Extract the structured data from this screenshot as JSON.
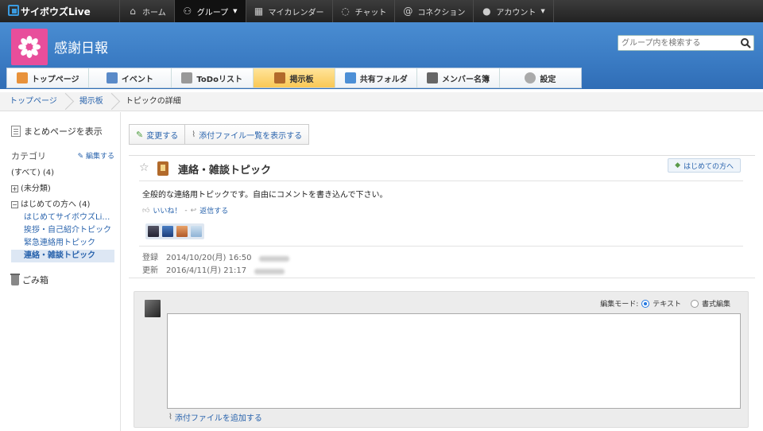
{
  "topnav": {
    "logo_text": "サイボウズLive",
    "items": [
      {
        "label": "ホーム",
        "icon": "home-icon"
      },
      {
        "label": "グループ",
        "icon": "group-icon"
      },
      {
        "label": "マイカレンダー",
        "icon": "calendar-icon"
      },
      {
        "label": "チャット",
        "icon": "chat-icon"
      },
      {
        "label": "コネクション",
        "icon": "at-icon"
      },
      {
        "label": "アカウント",
        "icon": "person-icon"
      }
    ]
  },
  "header": {
    "group_title": "感謝日報",
    "search_placeholder": "グループ内を検索する"
  },
  "tabs": [
    {
      "label": "トップページ",
      "color": "#e8923b"
    },
    {
      "label": "イベント",
      "color": "#5a8ac8"
    },
    {
      "label": "ToDoリスト",
      "color": "#999999"
    },
    {
      "label": "掲示板",
      "color": "#b26a2b"
    },
    {
      "label": "共有フォルダ",
      "color": "#4c8fd6"
    },
    {
      "label": "メンバー名簿",
      "color": "#666666"
    },
    {
      "label": "設定",
      "color": "#aaaaaa"
    }
  ],
  "breadcrumb": [
    "トップページ",
    "掲示板",
    "トピックの詳細"
  ],
  "sidebar": {
    "summary_label": "まとめページを表示",
    "category_label": "カテゴリ",
    "edit_label": "編集する",
    "all_label": "(すべて)  (4)",
    "uncat_label": "(未分類)",
    "group_label": "はじめての方へ  (4)",
    "topics": [
      "はじめてサイボウズLi…",
      "挨拶・自己紹介トピック",
      "緊急連絡用トピック",
      "連絡・雑談トピック"
    ],
    "trash_label": "ごみ箱"
  },
  "actions": {
    "edit": "変更する",
    "attachments": "添付ファイル一覧を表示する"
  },
  "topic": {
    "title": "連絡・雑談トピック",
    "tag": "はじめての方へ",
    "body": "全般的な連絡用トピックです。自由にコメントを書き込んで下さい。",
    "like": "いいね！",
    "sep": "-",
    "reply": "返信する",
    "registered_label": "登録",
    "registered_date": "2014/10/20(月) 16:50",
    "updated_label": "更新",
    "updated_date": "2016/4/11(月) 21:17"
  },
  "composer": {
    "mode_label": "編集モード:",
    "mode_text": "テキスト",
    "mode_rich": "書式編集",
    "attach_label": "添付ファイルを追加する"
  }
}
